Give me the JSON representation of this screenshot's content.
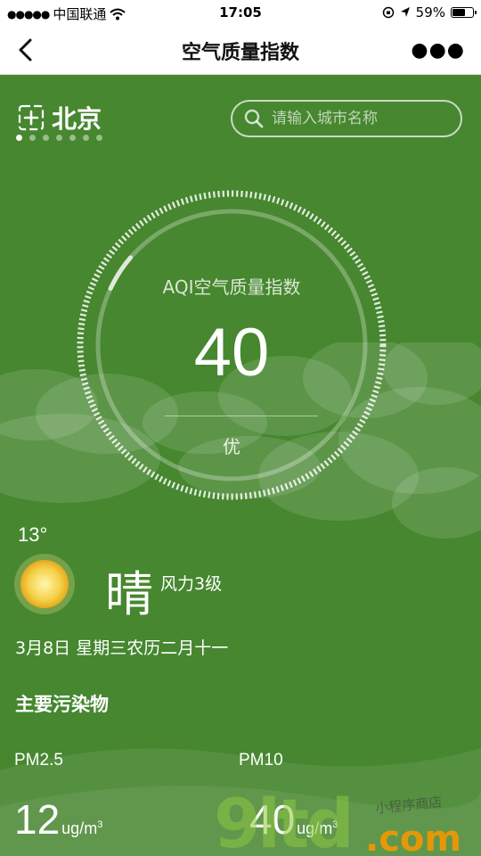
{
  "status_bar": {
    "carrier": "中国联通",
    "time": "17:05",
    "battery": "59%",
    "battery_level": 0.59
  },
  "nav": {
    "title": "空气质量指数",
    "back_icon": "chevron-left-icon",
    "more_icon": "more-dots-icon"
  },
  "city": {
    "name": "北京",
    "add_icon": "add-city-icon",
    "page_count": 7,
    "active_page": 0
  },
  "search": {
    "placeholder": "请输入城市名称"
  },
  "aqi": {
    "label": "AQI空气质量指数",
    "value": "40",
    "level": "优",
    "max": 500
  },
  "weather": {
    "temperature": "13°",
    "condition": "晴",
    "wind": "风力3级",
    "date": "3月8日 星期三农历二月十一",
    "icon": "sun-icon"
  },
  "pollutants": {
    "title": "主要污染物",
    "items": [
      {
        "name": "PM2.5",
        "value": "12",
        "unit": "ug/m",
        "unit_sup": "3"
      },
      {
        "name": "PM10",
        "value": "40",
        "unit": "ug/m",
        "unit_sup": "3"
      }
    ]
  },
  "watermark": {
    "brand": "9ltd",
    "domain": ".com",
    "tagline": "小程序商店"
  },
  "colors": {
    "background": "#46872f",
    "accent": "#ffffff",
    "watermark_green": "#8cc63f",
    "watermark_orange": "#f39800"
  }
}
